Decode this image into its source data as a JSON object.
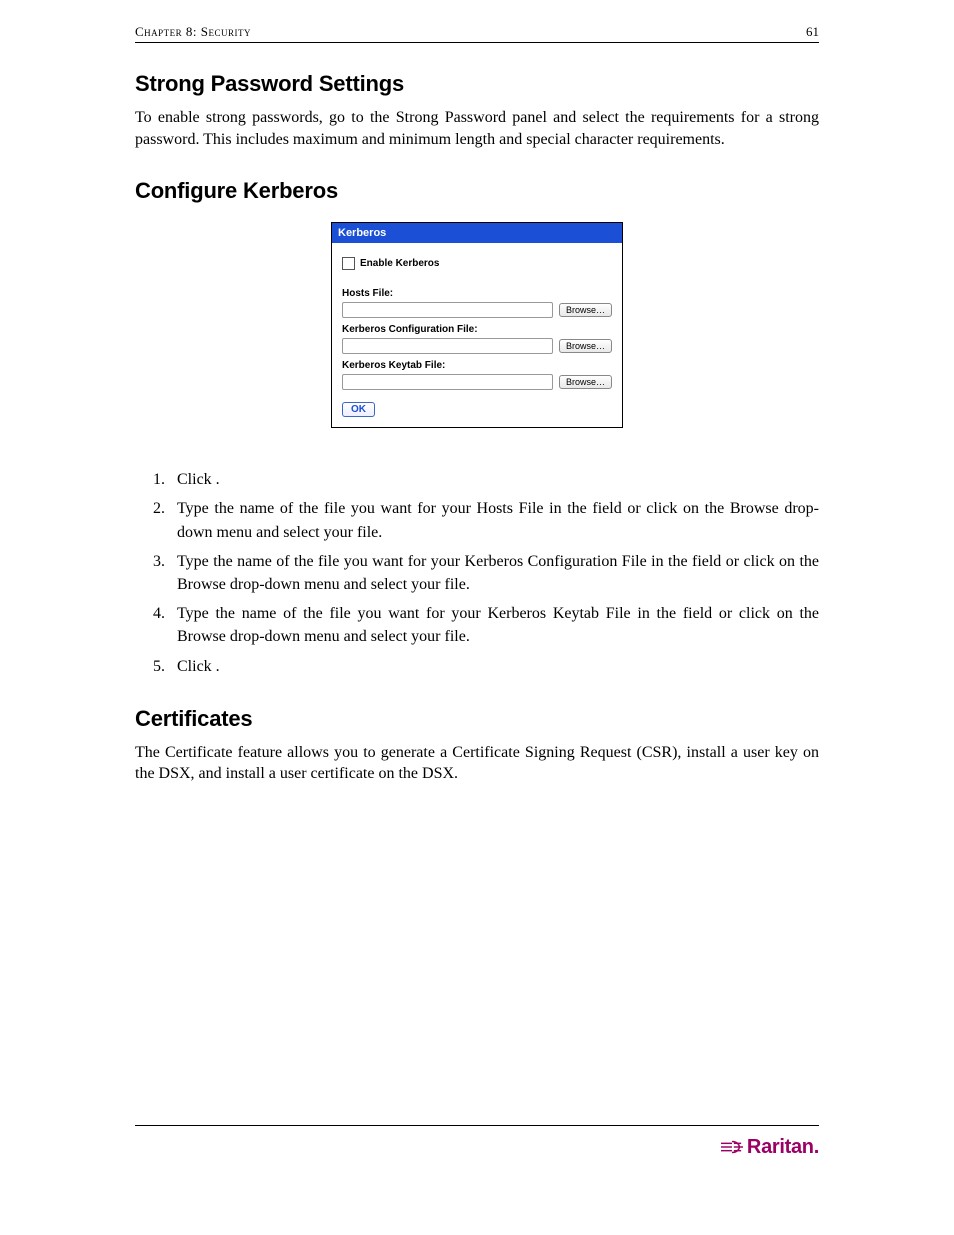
{
  "header": {
    "chapter": "Chapter 8: Security",
    "page_number": "61"
  },
  "sections": {
    "strong_password": {
      "heading": "Strong Password Settings",
      "paragraph": "To enable strong passwords, go to the Strong Password panel and select the requirements for a strong password. This includes maximum and minimum length and special character requirements."
    },
    "configure_kerberos": {
      "heading": "Configure Kerberos",
      "panel": {
        "title": "Kerberos",
        "enable_label": "Enable Kerberos",
        "hosts_label": "Hosts File:",
        "config_label": "Kerberos Configuration File:",
        "keytab_label": "Kerberos Keytab File:",
        "browse_label": "Browse…",
        "ok_label": "OK"
      },
      "steps": [
        "Click                               .",
        "Type the name of the file you want for your Hosts File in the                   field or click on the Browse drop-down menu and select your file.",
        "Type the name of the file you want for your Kerberos Configuration File in the                              field or click on the Browse drop-down menu and select your file.",
        "Type the name of the file you want for your Kerberos Keytab File in the                          field or click on the Browse drop-down menu and select your file.",
        "Click      ."
      ]
    },
    "certificates": {
      "heading": "Certificates",
      "paragraph": "The Certificate feature allows you to generate a Certificate Signing Request (CSR), install a user key on the DSX, and install a user certificate on the DSX."
    }
  },
  "footer": {
    "brand": "Raritan."
  }
}
